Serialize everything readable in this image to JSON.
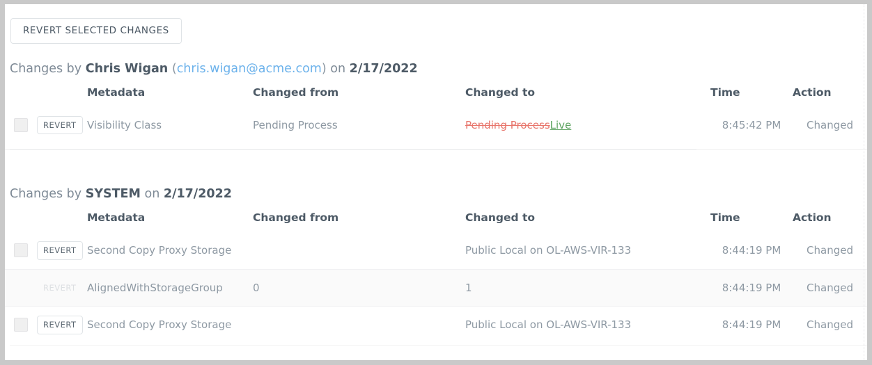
{
  "toolbar": {
    "revert_selected_label": "REVERT SELECTED CHANGES"
  },
  "columns": {
    "metadata": "Metadata",
    "changed_from": "Changed from",
    "changed_to": "Changed to",
    "time": "Time",
    "action": "Action"
  },
  "row_button_label": "REVERT",
  "groups": [
    {
      "prefix": "Changes by",
      "actor": "Chris Wigan",
      "email": "chris.wigan@acme.com",
      "paren_open": "(",
      "paren_close": ")",
      "on": "on",
      "date": "2/17/2022",
      "rows": [
        {
          "checkbox": true,
          "revert_enabled": true,
          "metadata": "Visibility Class",
          "changed_from": "Pending Process",
          "changed_to_deleted": "Pending Process",
          "changed_to_inserted": "Live",
          "changed_to_plain": "",
          "time": "8:45:42 PM",
          "action": "Changed",
          "striped": false
        }
      ]
    },
    {
      "prefix": "Changes by",
      "actor": "SYSTEM",
      "email": "",
      "paren_open": "",
      "paren_close": "",
      "on": "on",
      "date": "2/17/2022",
      "rows": [
        {
          "checkbox": true,
          "revert_enabled": true,
          "metadata": "Second Copy Proxy Storage",
          "changed_from": "",
          "changed_to_deleted": "",
          "changed_to_inserted": "",
          "changed_to_plain": "Public Local on OL-AWS-VIR-133",
          "time": "8:44:19 PM",
          "action": "Changed",
          "striped": false
        },
        {
          "checkbox": false,
          "revert_enabled": false,
          "metadata": "AlignedWithStorageGroup",
          "changed_from": "0",
          "changed_to_deleted": "",
          "changed_to_inserted": "",
          "changed_to_plain": "1",
          "time": "8:44:19 PM",
          "action": "Changed",
          "striped": true
        },
        {
          "checkbox": true,
          "revert_enabled": true,
          "metadata": "Second Copy Proxy Storage",
          "changed_from": "",
          "changed_to_deleted": "",
          "changed_to_inserted": "",
          "changed_to_plain": "Public Local on OL-AWS-VIR-133",
          "time": "8:44:19 PM",
          "action": "Changed",
          "striped": false
        }
      ]
    }
  ]
}
